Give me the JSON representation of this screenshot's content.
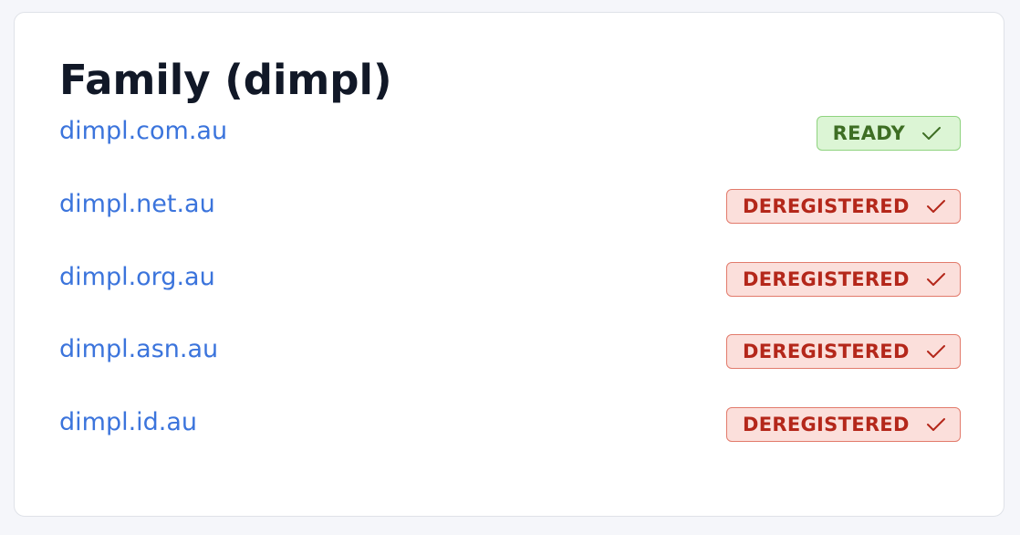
{
  "card": {
    "title": "Family (dimpl)",
    "domains": [
      {
        "name": "dimpl.com.au",
        "status": "READY",
        "status_type": "ready"
      },
      {
        "name": "dimpl.net.au",
        "status": "DEREGISTERED",
        "status_type": "deregistered"
      },
      {
        "name": "dimpl.org.au",
        "status": "DEREGISTERED",
        "status_type": "deregistered"
      },
      {
        "name": "dimpl.asn.au",
        "status": "DEREGISTERED",
        "status_type": "deregistered"
      },
      {
        "name": "dimpl.id.au",
        "status": "DEREGISTERED",
        "status_type": "deregistered"
      }
    ]
  },
  "icons": {
    "status_icon": "check-icon"
  },
  "colors": {
    "link": "#3b74dc",
    "ready_bg": "#dcf5d5",
    "ready_text": "#3e6e24",
    "deregistered_bg": "#fbdfdb",
    "deregistered_text": "#b4271a"
  }
}
